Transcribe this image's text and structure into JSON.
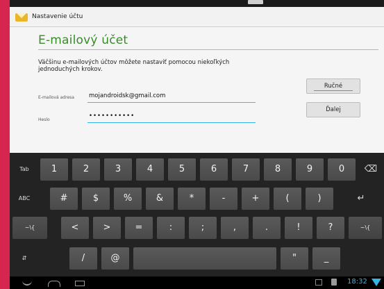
{
  "actionbar": {
    "title": "Nastavenie účtu",
    "icon": "mail-icon"
  },
  "page": {
    "title": "E-mailový účet",
    "intro": "Väčšinu e-mailových účtov môžete nastaviť pomocou niekoľkých jednoduchých krokov."
  },
  "form": {
    "email_label": "E-mailová adresa",
    "email_value": "mojandroidsk@gmail.com",
    "password_label": "Heslo",
    "password_value": "•••••••••••"
  },
  "buttons": {
    "manual": "Ručné",
    "next": "Ďalej"
  },
  "keyboard": {
    "row1": [
      "Tab",
      "1",
      "2",
      "3",
      "4",
      "5",
      "6",
      "7",
      "8",
      "9",
      "0",
      "⌫"
    ],
    "row2": [
      "ABC",
      "#",
      "$",
      "%",
      "&",
      "*",
      "-",
      "+",
      "(",
      ")",
      "↵"
    ],
    "row3": [
      "~\\{",
      "<",
      ">",
      "=",
      ":",
      ";",
      ",",
      ".",
      "!",
      "?",
      "~\\{"
    ],
    "row4": [
      "⇵",
      "/",
      "@",
      "\"",
      "_"
    ]
  },
  "status": {
    "time": "18:32"
  },
  "colors": {
    "accent": "#33b5e5",
    "title_green": "#3a8a2a",
    "edge": "#d6264f"
  }
}
